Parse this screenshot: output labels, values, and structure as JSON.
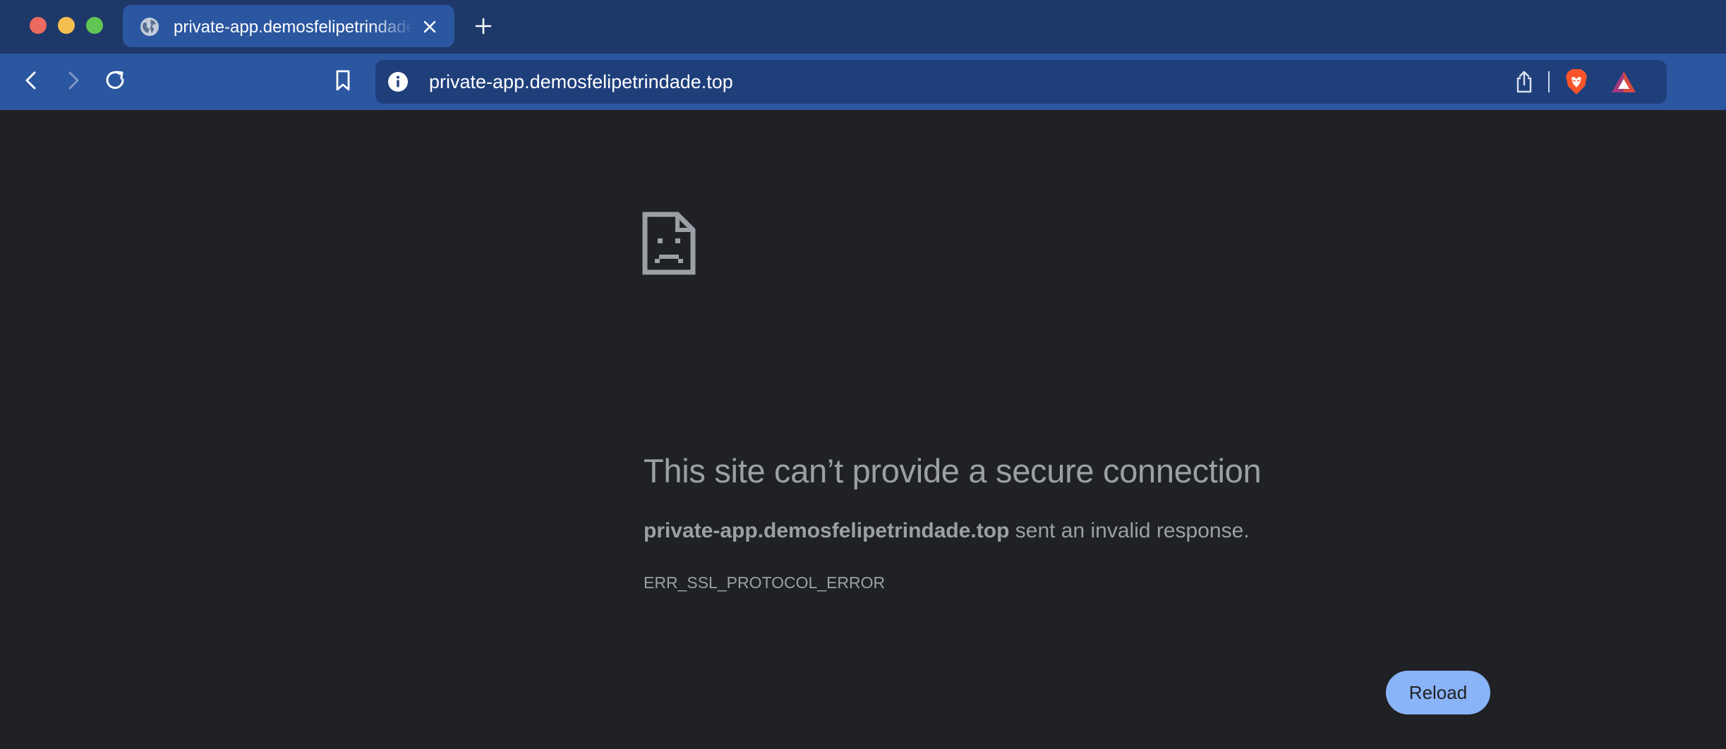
{
  "window": {
    "traffic_lights": [
      "close",
      "minimize",
      "zoom"
    ]
  },
  "tab": {
    "title": "private-app.demosfelipetrindade.top",
    "favicon": "globe-icon",
    "close_icon": "close-icon"
  },
  "toolbar": {
    "new_tab_icon": "plus-icon",
    "back_icon": "chevron-left-icon",
    "forward_icon": "chevron-right-icon",
    "reload_icon": "reload-icon",
    "bookmark_icon": "bookmark-icon"
  },
  "omnibox": {
    "site_info_icon": "info-icon",
    "url": "private-app.demosfelipetrindade.top",
    "share_icon": "share-icon",
    "shields_icon": "brave-lion-icon",
    "rewards_icon": "brave-rewards-triangle-icon"
  },
  "error_page": {
    "icon": "sad-document-icon",
    "heading": "This site can’t provide a secure connection",
    "host": "private-app.demosfelipetrindade.top",
    "message_suffix": " sent an invalid response.",
    "error_code": "ERR_SSL_PROTOCOL_ERROR",
    "reload_label": "Reload"
  },
  "colors": {
    "tabstrip": "#1d3869",
    "toolbar": "#2b56a0",
    "omnibox": "#1f3f7b",
    "page_background": "#202124",
    "error_text": "#9aa0a6",
    "reload_button": "#8ab4f8"
  }
}
